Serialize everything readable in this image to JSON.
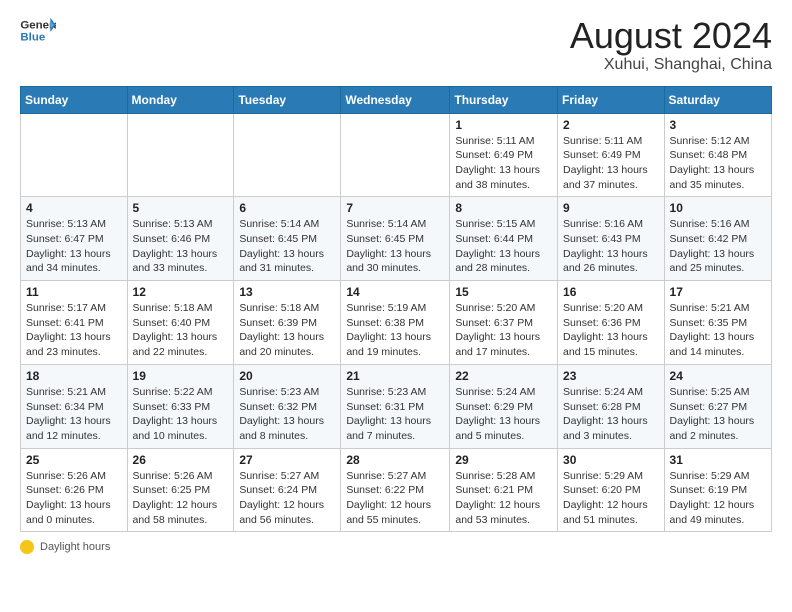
{
  "header": {
    "logo_line1": "General",
    "logo_line2": "Blue",
    "title": "August 2024",
    "subtitle": "Xuhui, Shanghai, China"
  },
  "days_of_week": [
    "Sunday",
    "Monday",
    "Tuesday",
    "Wednesday",
    "Thursday",
    "Friday",
    "Saturday"
  ],
  "weeks": [
    [
      {
        "num": "",
        "info": ""
      },
      {
        "num": "",
        "info": ""
      },
      {
        "num": "",
        "info": ""
      },
      {
        "num": "",
        "info": ""
      },
      {
        "num": "1",
        "info": "Sunrise: 5:11 AM\nSunset: 6:49 PM\nDaylight: 13 hours\nand 38 minutes."
      },
      {
        "num": "2",
        "info": "Sunrise: 5:11 AM\nSunset: 6:49 PM\nDaylight: 13 hours\nand 37 minutes."
      },
      {
        "num": "3",
        "info": "Sunrise: 5:12 AM\nSunset: 6:48 PM\nDaylight: 13 hours\nand 35 minutes."
      }
    ],
    [
      {
        "num": "4",
        "info": "Sunrise: 5:13 AM\nSunset: 6:47 PM\nDaylight: 13 hours\nand 34 minutes."
      },
      {
        "num": "5",
        "info": "Sunrise: 5:13 AM\nSunset: 6:46 PM\nDaylight: 13 hours\nand 33 minutes."
      },
      {
        "num": "6",
        "info": "Sunrise: 5:14 AM\nSunset: 6:45 PM\nDaylight: 13 hours\nand 31 minutes."
      },
      {
        "num": "7",
        "info": "Sunrise: 5:14 AM\nSunset: 6:45 PM\nDaylight: 13 hours\nand 30 minutes."
      },
      {
        "num": "8",
        "info": "Sunrise: 5:15 AM\nSunset: 6:44 PM\nDaylight: 13 hours\nand 28 minutes."
      },
      {
        "num": "9",
        "info": "Sunrise: 5:16 AM\nSunset: 6:43 PM\nDaylight: 13 hours\nand 26 minutes."
      },
      {
        "num": "10",
        "info": "Sunrise: 5:16 AM\nSunset: 6:42 PM\nDaylight: 13 hours\nand 25 minutes."
      }
    ],
    [
      {
        "num": "11",
        "info": "Sunrise: 5:17 AM\nSunset: 6:41 PM\nDaylight: 13 hours\nand 23 minutes."
      },
      {
        "num": "12",
        "info": "Sunrise: 5:18 AM\nSunset: 6:40 PM\nDaylight: 13 hours\nand 22 minutes."
      },
      {
        "num": "13",
        "info": "Sunrise: 5:18 AM\nSunset: 6:39 PM\nDaylight: 13 hours\nand 20 minutes."
      },
      {
        "num": "14",
        "info": "Sunrise: 5:19 AM\nSunset: 6:38 PM\nDaylight: 13 hours\nand 19 minutes."
      },
      {
        "num": "15",
        "info": "Sunrise: 5:20 AM\nSunset: 6:37 PM\nDaylight: 13 hours\nand 17 minutes."
      },
      {
        "num": "16",
        "info": "Sunrise: 5:20 AM\nSunset: 6:36 PM\nDaylight: 13 hours\nand 15 minutes."
      },
      {
        "num": "17",
        "info": "Sunrise: 5:21 AM\nSunset: 6:35 PM\nDaylight: 13 hours\nand 14 minutes."
      }
    ],
    [
      {
        "num": "18",
        "info": "Sunrise: 5:21 AM\nSunset: 6:34 PM\nDaylight: 13 hours\nand 12 minutes."
      },
      {
        "num": "19",
        "info": "Sunrise: 5:22 AM\nSunset: 6:33 PM\nDaylight: 13 hours\nand 10 minutes."
      },
      {
        "num": "20",
        "info": "Sunrise: 5:23 AM\nSunset: 6:32 PM\nDaylight: 13 hours\nand 8 minutes."
      },
      {
        "num": "21",
        "info": "Sunrise: 5:23 AM\nSunset: 6:31 PM\nDaylight: 13 hours\nand 7 minutes."
      },
      {
        "num": "22",
        "info": "Sunrise: 5:24 AM\nSunset: 6:29 PM\nDaylight: 13 hours\nand 5 minutes."
      },
      {
        "num": "23",
        "info": "Sunrise: 5:24 AM\nSunset: 6:28 PM\nDaylight: 13 hours\nand 3 minutes."
      },
      {
        "num": "24",
        "info": "Sunrise: 5:25 AM\nSunset: 6:27 PM\nDaylight: 13 hours\nand 2 minutes."
      }
    ],
    [
      {
        "num": "25",
        "info": "Sunrise: 5:26 AM\nSunset: 6:26 PM\nDaylight: 13 hours\nand 0 minutes."
      },
      {
        "num": "26",
        "info": "Sunrise: 5:26 AM\nSunset: 6:25 PM\nDaylight: 12 hours\nand 58 minutes."
      },
      {
        "num": "27",
        "info": "Sunrise: 5:27 AM\nSunset: 6:24 PM\nDaylight: 12 hours\nand 56 minutes."
      },
      {
        "num": "28",
        "info": "Sunrise: 5:27 AM\nSunset: 6:22 PM\nDaylight: 12 hours\nand 55 minutes."
      },
      {
        "num": "29",
        "info": "Sunrise: 5:28 AM\nSunset: 6:21 PM\nDaylight: 12 hours\nand 53 minutes."
      },
      {
        "num": "30",
        "info": "Sunrise: 5:29 AM\nSunset: 6:20 PM\nDaylight: 12 hours\nand 51 minutes."
      },
      {
        "num": "31",
        "info": "Sunrise: 5:29 AM\nSunset: 6:19 PM\nDaylight: 12 hours\nand 49 minutes."
      }
    ]
  ],
  "footer": {
    "daylight_label": "Daylight hours"
  }
}
